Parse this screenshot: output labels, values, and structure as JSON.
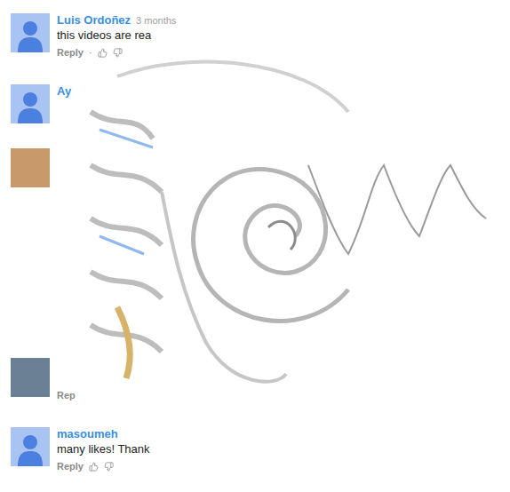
{
  "comments": [
    {
      "kind": "full",
      "avatar": "default",
      "author": "Luis Ordoñez",
      "time": "3 months",
      "text": "this videos are rea",
      "reply": "Reply",
      "separator": "·",
      "votes": true
    },
    {
      "kind": "name-only",
      "avatar": "default",
      "author": "Ay"
    },
    {
      "kind": "hidden",
      "avatar": "photo",
      "color": "#c89a6a"
    },
    {
      "kind": "reply-only",
      "avatar": "photo",
      "color": "#6b7f95",
      "reply": "Rep"
    },
    {
      "kind": "full",
      "avatar": "default",
      "author": "masoumeh",
      "text": "many likes! Thank",
      "reply": "Reply",
      "votes": true
    }
  ]
}
